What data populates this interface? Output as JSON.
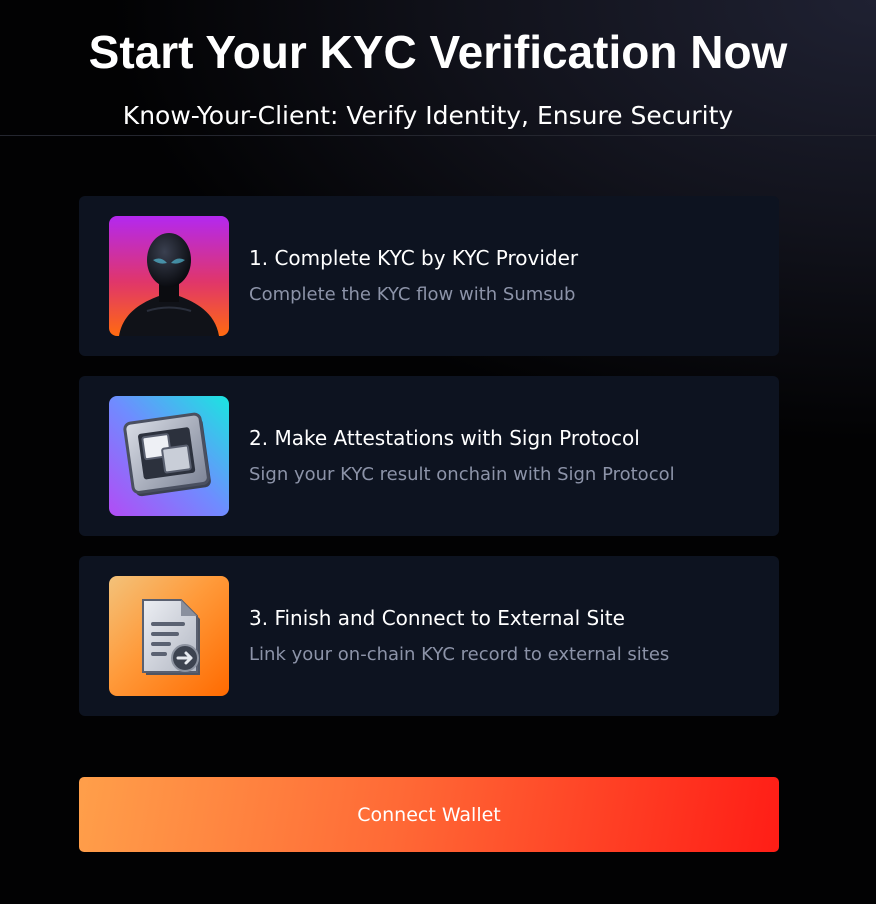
{
  "header": {
    "title": "Start Your KYC Verification Now",
    "subtitle": "Know-Your-Client: Verify Identity, Ensure Security"
  },
  "steps": [
    {
      "title": "1. Complete KYC by KYC Provider",
      "description": "Complete the KYC flow with Sumsub",
      "icon": "kyc-avatar-icon"
    },
    {
      "title": "2. Make Attestations with Sign Protocol",
      "description": "Sign your KYC result onchain with Sign Protocol",
      "icon": "attestation-chip-icon"
    },
    {
      "title": "3. Finish and Connect to External Site",
      "description": "Link your on-chain KYC record to external sites",
      "icon": "document-link-icon"
    }
  ],
  "actions": {
    "connect_wallet_label": "Connect Wallet"
  },
  "colors": {
    "background": "#020203",
    "card": "#0d1320",
    "description_text": "#8c93a8",
    "button_gradient_start": "#ff9f4a",
    "button_gradient_end": "#ff1d16"
  }
}
